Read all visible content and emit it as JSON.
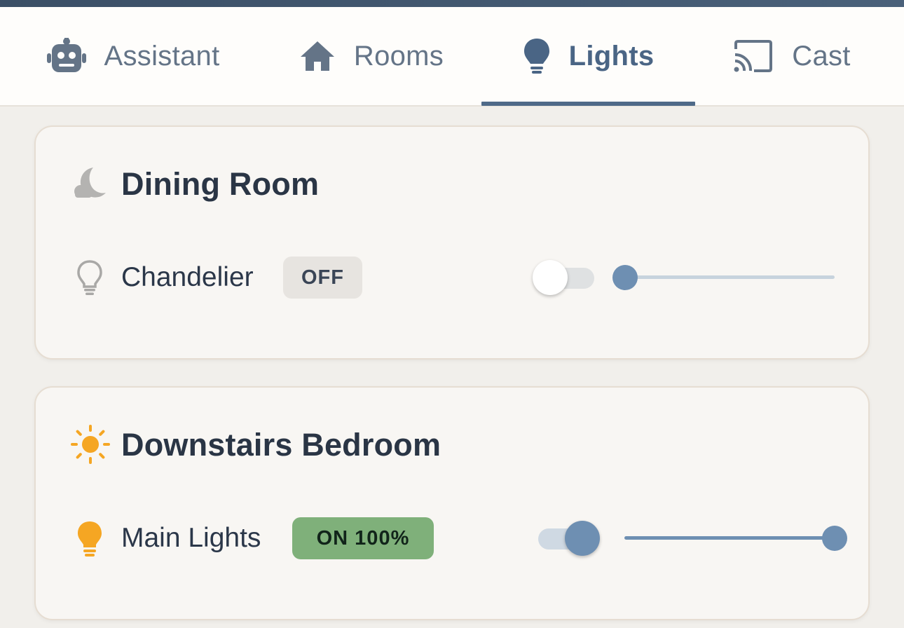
{
  "tabs": [
    {
      "label": "Assistant",
      "icon": "robot-icon",
      "active": false
    },
    {
      "label": "Rooms",
      "icon": "home-icon",
      "active": false
    },
    {
      "label": "Lights",
      "icon": "lightbulb-icon",
      "active": true
    },
    {
      "label": "Cast",
      "icon": "cast-icon",
      "active": false
    }
  ],
  "rooms": [
    {
      "name": "Dining Room",
      "icon": "moon-icon",
      "device": {
        "name": "Chandelier",
        "icon": "lightbulb-outline-icon",
        "status": "OFF",
        "on": false,
        "brightness": 0
      }
    },
    {
      "name": "Downstairs Bedroom",
      "icon": "sun-icon",
      "device": {
        "name": "Main Lights",
        "icon": "lightbulb-icon",
        "status": "ON 100%",
        "on": true,
        "brightness": 100
      }
    }
  ],
  "colors": {
    "accent": "#4f6a89",
    "slider": "#6e8fb2",
    "on_badge": "#7fb07a",
    "bulb_on": "#f5a623",
    "sun": "#f5a623"
  }
}
